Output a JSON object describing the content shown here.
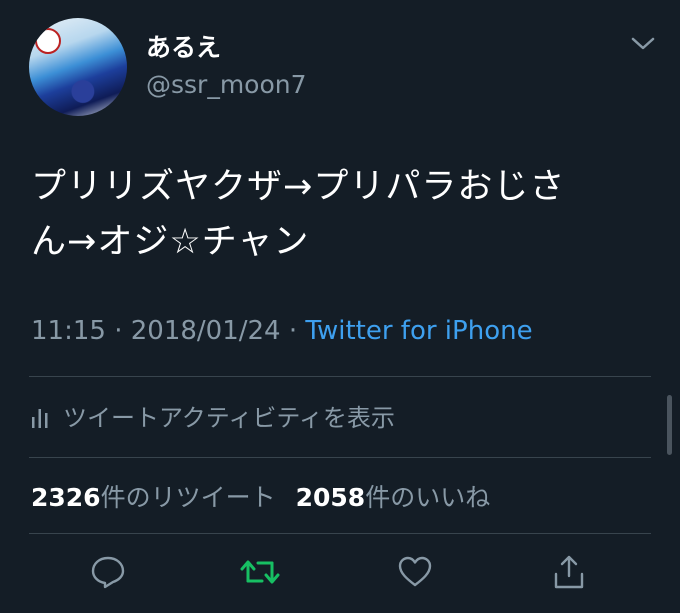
{
  "user": {
    "display_name": "あるえ",
    "handle": "@ssr_moon7"
  },
  "tweet": {
    "text": "プリリズヤクザ→プリパラおじさ\nん→オジ☆チャン"
  },
  "meta": {
    "time": "11:15",
    "separator": "·",
    "date": "2018/01/24",
    "source": "Twitter for iPhone"
  },
  "activity": {
    "label": "ツイートアクティビティを表示",
    "icon": "bar-chart-icon"
  },
  "stats": {
    "retweet_count": "2326",
    "retweet_label": "件のリツイート",
    "like_count": "2058",
    "like_label": "件のいいね"
  },
  "actions": {
    "icons": [
      "reply-icon",
      "retweet-icon",
      "like-icon",
      "share-icon"
    ],
    "retweet_color": "#17bf63"
  },
  "colors": {
    "background": "#141d26",
    "link": "#3ea0ef",
    "secondary_text": "#8899a6",
    "divider": "#38444d"
  }
}
